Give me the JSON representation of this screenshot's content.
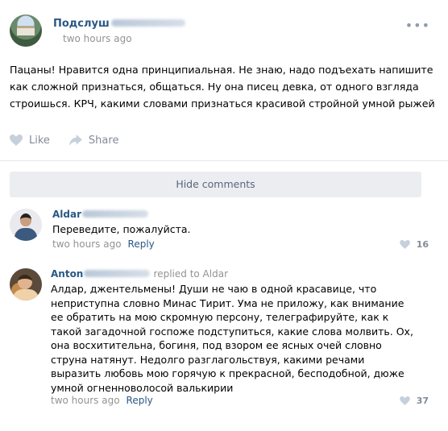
{
  "post": {
    "group_name": "Подслуш",
    "time": "two hours ago",
    "platform_icon": "apple-icon",
    "menu_icon": "dots-icon",
    "text": "Пацаны! Нравится одна принципиальная. Не знаю, надо подъехать напишите как сложной признаться, общаться. Ну она писец девка, от одного взгляда строишься. КРЧ, какими словами признаться красивой стройной умной рыжей",
    "like_label": "Like",
    "share_label": "Share"
  },
  "hide_comments_label": "Hide comments",
  "comments": [
    {
      "author": "Aldar",
      "text": "Переведите, пожалуйста.",
      "time": "two hours ago",
      "reply_label": "Reply",
      "likes": "16"
    },
    {
      "author": "Anton",
      "reply_to": "replied to Aldar",
      "text": "Алдар, джентельмены! Души не чаю в одной красавице, что неприступна словно Минас Тирит. Ума не приложу, как внимание ее обратить на мою скромную персону, телеграфируйте, как к такой загадочной госпоже подступиться, какие слова молвить. Ох, она восхитительна, богиня, под взором ее ясных очей словно струна натянут. Недолго разглагольствуя, какими речами выразить любовь мою горячую к прекрасной, бесподобной, дюже умной огненноволосой валькирии",
      "time": "two hours ago",
      "reply_label": "Reply",
      "likes": "37"
    }
  ],
  "colors": {
    "link": "#2a5885",
    "meta": "#939393",
    "action": "#828a99",
    "hide_bg": "#ecedf0"
  }
}
